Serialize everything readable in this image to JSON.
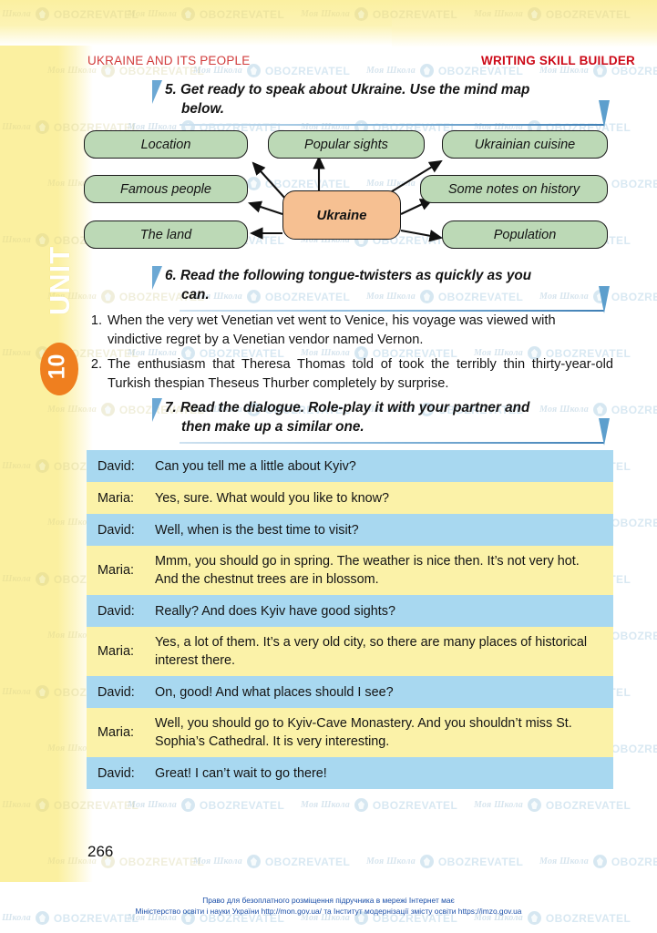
{
  "header": {
    "left": "UKRAINE AND ITS PEOPLE",
    "right": "WRITING SKILL BUILDER"
  },
  "unit_tab": {
    "word": "UNIT",
    "number": "10",
    "oval_color": "#ef7f1f"
  },
  "tasks": [
    {
      "number": "5.",
      "line1": "5. Get ready to speak about Ukraine. Use the mind map",
      "line2": "below."
    },
    {
      "number": "6.",
      "line1": "6. Read the following tongue-twisters as quickly as you",
      "line2": "can."
    },
    {
      "number": "7.",
      "line1": "7. Read the dialogue. Role-play it with your partner and",
      "line2": "then make up a similar one."
    }
  ],
  "mindmap": {
    "center": "Ukraine",
    "center_color": "#f6c092",
    "node_color": "#bcd9b6",
    "nodes": [
      {
        "label": "Location"
      },
      {
        "label": "Popular sights"
      },
      {
        "label": "Ukrainian cuisine"
      },
      {
        "label": "Famous people"
      },
      {
        "label": "Some notes on history"
      },
      {
        "label": "The land"
      },
      {
        "label": "Population"
      }
    ]
  },
  "tongue_twisters": [
    {
      "number": "1.",
      "text": "When the very wet Venetian vet went to Venice, his voyage was viewed with vindictive regret by a Venetian vendor named Vernon."
    },
    {
      "number": "2.",
      "text": "The enthusiasm that Theresa Thomas told of took the terribly thin thirty-year-old Turkish thespian Theseus Thurber completely by surprise."
    }
  ],
  "dialogue": {
    "colors": {
      "blue": "#a8d8f0",
      "yellow": "#fbf2a8"
    },
    "rows": [
      {
        "speaker": "David:",
        "line": "Can you tell me a little about Kyiv?",
        "tone": "blue"
      },
      {
        "speaker": "Maria:",
        "line": "Yes, sure. What would you like to know?",
        "tone": "yellow"
      },
      {
        "speaker": "David:",
        "line": "Well, when is the best time to visit?",
        "tone": "blue"
      },
      {
        "speaker": "Maria:",
        "line": "Mmm, you should go in spring. The weather is nice then. It’s not very hot. And the chestnut trees are in blossom.",
        "tone": "yellow"
      },
      {
        "speaker": "David:",
        "line": "Really? And does Kyiv have good sights?",
        "tone": "blue"
      },
      {
        "speaker": "Maria:",
        "line": "Yes, a lot of them. It’s a very old city, so there are many places of historical interest there.",
        "tone": "yellow"
      },
      {
        "speaker": "David:",
        "line": "On, good! And what places should I see?",
        "tone": "blue"
      },
      {
        "speaker": "Maria:",
        "line": "Well, you should go to Kyiv-Cave Monastery. And you shouldn’t miss St. Sophia’s Cathedral. It is very interesting.",
        "tone": "yellow"
      },
      {
        "speaker": "David:",
        "line": "Great! I can’t wait to go there!",
        "tone": "blue"
      }
    ]
  },
  "page_number": "266",
  "footer": {
    "line1": "Право для безоплатного розміщення підручника в мережі Інтернет має",
    "line2": "Міністерство освіти і науки України http://mon.gov.ua/ та Інститут модернізації змісту освіти https://imzo.gov.ua"
  },
  "watermark": {
    "school": "Моя Школа",
    "brand": "OBOZREVATEL",
    "logo_icon": "shield-logo-icon"
  }
}
